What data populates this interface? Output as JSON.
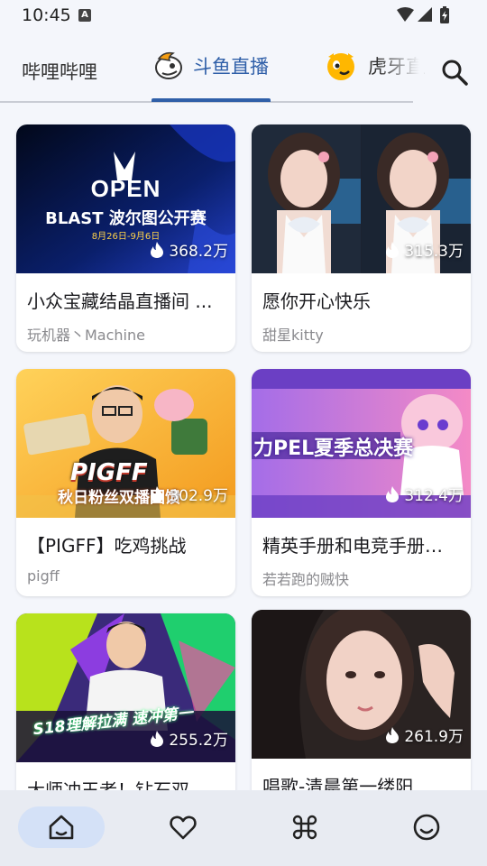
{
  "status": {
    "time": "10:45",
    "notification_glyph": "A"
  },
  "tabs": [
    {
      "label": "哔哩哔哩",
      "icon": ""
    },
    {
      "label": "斗鱼直播",
      "icon": "douyu-fish-icon"
    },
    {
      "label": "虎牙直",
      "icon": "huya-mascot-icon"
    }
  ],
  "active_tab": 1,
  "accent_color": "#2f5fa8",
  "cards": [
    {
      "title": "小众宝藏结晶直播间 ...",
      "streamer": "玩机器丶Machine",
      "viewers": "368.2万",
      "thumb_text": [
        "OPEN",
        "BLAST 波尔图公开赛",
        "8月26日-9月6日"
      ]
    },
    {
      "title": "愿你开心快乐",
      "streamer": "甜星kitty",
      "viewers": "315.3万",
      "thumb_text": []
    },
    {
      "title": "【PIGFF】吃鸡挑战",
      "streamer": "pigff",
      "viewers": "302.9万",
      "thumb_text": [
        "PIGFF",
        "秋日粉丝双播回馈"
      ]
    },
    {
      "title": "精英手册和电竞手册…",
      "streamer": "若若跑的贼快",
      "viewers": "312.4万",
      "thumb_text": [
        "力PEL夏季总决赛"
      ]
    },
    {
      "title": "大师冲王者！钻石双…",
      "streamer": "",
      "viewers": "255.2万",
      "thumb_text": [
        "S18理解拉满 速冲第一"
      ]
    },
    {
      "title": "唱歌-清晨第一缕阳…",
      "streamer": "",
      "viewers": "261.9万",
      "thumb_text": []
    }
  ],
  "bottom_nav": [
    {
      "icon": "home-icon",
      "active": true
    },
    {
      "icon": "heart-icon",
      "active": false
    },
    {
      "icon": "command-icon",
      "active": false
    },
    {
      "icon": "smile-icon",
      "active": false
    }
  ]
}
